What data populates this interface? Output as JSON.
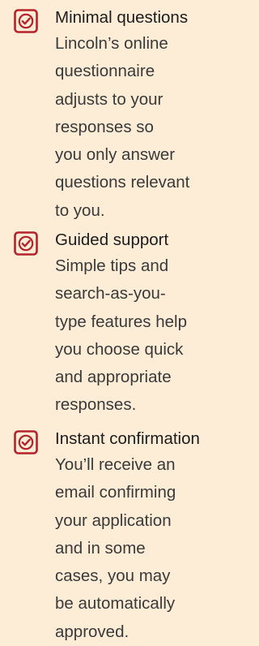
{
  "features": [
    {
      "title": "Minimal questions",
      "lines": [
        "Lincoln’s online",
        "questionnaire",
        "adjusts to your",
        "responses so",
        "you only answer",
        "questions relevant",
        "to you."
      ]
    },
    {
      "title": "Guided support",
      "lines": [
        "Simple tips and",
        "search-as-you-",
        "type features help",
        "you choose quick",
        "and appropriate",
        "responses."
      ]
    },
    {
      "title": "Instant confirmation",
      "lines": [
        "You’ll receive an",
        "email confirming",
        "your application",
        "and in some",
        "cases, you may",
        "be automatically",
        "approved."
      ]
    }
  ],
  "icons": {
    "check": "checkbox-checked-icon"
  },
  "colors": {
    "background": "#fdecd6",
    "accent": "#b5232a",
    "title": "#1c1c1c",
    "body": "#3a3a3a"
  }
}
